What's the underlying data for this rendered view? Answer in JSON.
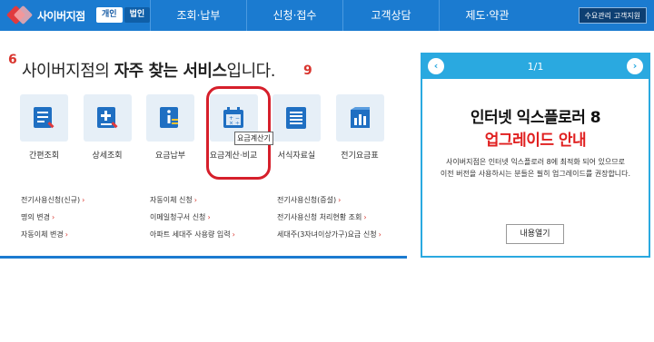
{
  "header": {
    "brand": "사이버지점",
    "toggle": {
      "active": "개인",
      "inactive": "법인"
    },
    "nav": [
      "조회·납부",
      "신청·접수",
      "고객상담",
      "제도·약관"
    ],
    "top_button": "수요관리 고객지원"
  },
  "main": {
    "headline_plain1": "사이버지점의 ",
    "headline_bold": "자주 찾는 서비스",
    "headline_plain2": "입니다.",
    "deco_left": "6",
    "deco_right": "9",
    "services": [
      {
        "label": "간편조회",
        "icon": "list-search-icon"
      },
      {
        "label": "상세조회",
        "icon": "detail-search-icon"
      },
      {
        "label": "요금납부",
        "icon": "payment-info-icon"
      },
      {
        "label": "요금계산·비교",
        "icon": "calculator-icon"
      },
      {
        "label": "서식자료실",
        "icon": "forms-icon"
      },
      {
        "label": "전기요금표",
        "icon": "rate-chart-icon"
      }
    ],
    "tooltip": "요금계산기",
    "links": {
      "col1": [
        "전기사용신청(신규)",
        "명의 변경",
        "자동이체 변경"
      ],
      "col2": [
        "자동이체 신청",
        "이메일청구서 신청",
        "아파트 세대주 사용량 입력"
      ],
      "col3": [
        "전기사용신청(증설)",
        "전기사용신청 처리현황 조회",
        "세대주(3자녀이상가구)요금 신청"
      ]
    }
  },
  "panel": {
    "page": "1/1",
    "title_line1": "인터넷 익스플로러 8",
    "title_line2": "업그레이드 안내",
    "desc_line1": "사이버지점은 인터넷 익스플로러 8에 최적화 되어 있으므로",
    "desc_line2": "이전 버전을 사용하시는 분들은 필히 업그레이드를 권장합니다.",
    "button": "내용열기"
  },
  "colors": {
    "primary_blue": "#1b7bd0",
    "panel_blue": "#2aa9e0",
    "highlight_red": "#d61f2b",
    "tile_bg": "#e6eff7"
  }
}
